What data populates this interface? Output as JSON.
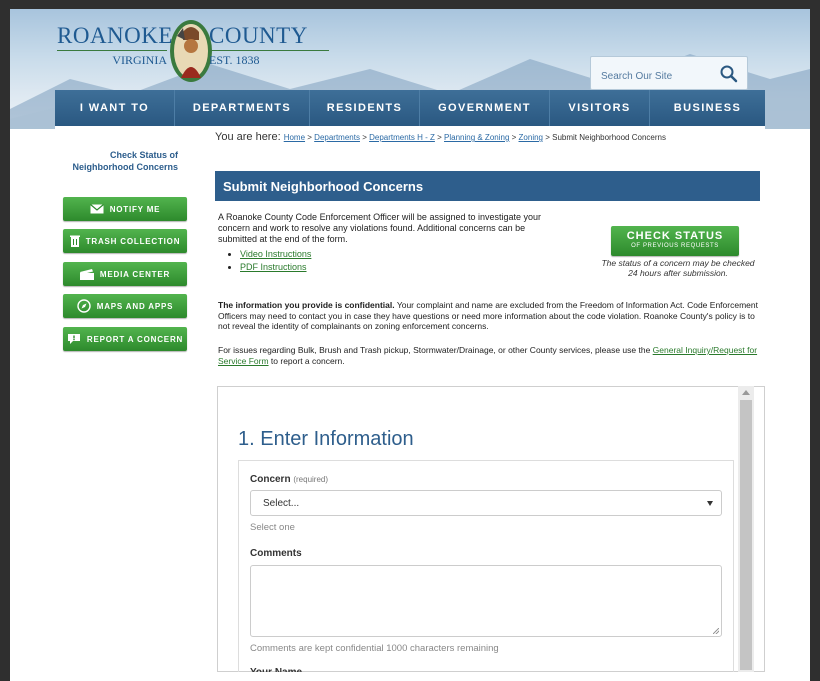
{
  "header": {
    "logo_left_name": "ROANOKE",
    "logo_left_sub": "VIRGINIA",
    "logo_right_name": "COUNTY",
    "logo_right_sub": "EST. 1838",
    "search_placeholder": "Search Our Site"
  },
  "nav": {
    "items": [
      {
        "label": "I WANT TO"
      },
      {
        "label": "DEPARTMENTS"
      },
      {
        "label": "RESIDENTS"
      },
      {
        "label": "GOVERNMENT"
      },
      {
        "label": "VISITORS"
      },
      {
        "label": "BUSINESS"
      }
    ]
  },
  "sidebar": {
    "check_status": "Check Status of Neighborhood Concerns",
    "buttons": [
      {
        "label": "NOTIFY ME",
        "icon": "mail-icon"
      },
      {
        "label": "TRASH COLLECTION",
        "icon": "trash-icon"
      },
      {
        "label": "MEDIA CENTER",
        "icon": "clapper-icon"
      },
      {
        "label": "MAPS AND APPS",
        "icon": "compass-icon"
      },
      {
        "label": "REPORT A CONCERN",
        "icon": "speech-bubble-icon"
      }
    ]
  },
  "breadcrumb": {
    "prefix": "You are here: ",
    "items": [
      "Home",
      "Departments",
      "Departments H - Z",
      "Planning & Zoning",
      "Zoning"
    ],
    "current": "Submit Neighborhood Concerns",
    "separator": " > "
  },
  "main": {
    "title": "Submit Neighborhood Concerns",
    "intro": "A Roanoke County Code Enforcement Officer will be assigned to investigate your concern and work to resolve any violations found. Additional concerns can be submitted at the end of the form.",
    "links": [
      "Video Instructions",
      "PDF Instructions"
    ],
    "check_btn_big": "CHECK STATUS",
    "check_btn_small": "OF PREVIOUS REQUESTS",
    "check_note": "The status of a concern may be checked 24 hours after submission.",
    "conf_bold": "The information you provide is confidential.",
    "conf_text": " Your complaint and name are excluded from the Freedom of Information Act. Code Enforcement Officers may need to contact you in case they have questions or need more information about the code violation. Roanoke County's policy is to not reveal the identity of complainants on zoning enforcement concerns.",
    "issues_text": "For issues regarding Bulk, Brush and Trash pickup, Stormwater/Drainage, or other County services, please use the ",
    "issues_link": "General Inquiry/Request for Service Form",
    "issues_end": " to report a concern."
  },
  "form": {
    "title": "1. Enter Information",
    "concern_label": "Concern",
    "concern_req": "(required)",
    "concern_value": "Select...",
    "concern_hint": "Select one",
    "comments_label": "Comments",
    "comments_hint": "Comments are kept confidential 1000 characters remaining",
    "next_label": "Your Name"
  },
  "colors": {
    "nav_blue": "#2a5881",
    "banner_blue": "#2e5e8c",
    "button_green": "#2d8a2c",
    "link_green": "#2a7a2c"
  }
}
